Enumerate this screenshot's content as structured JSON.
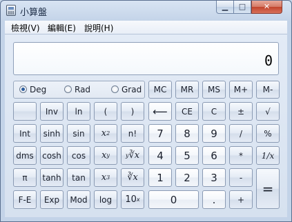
{
  "window": {
    "title": "小算盤"
  },
  "menu": {
    "items": [
      {
        "label": "檢視(V)"
      },
      {
        "label": "編輯(E)"
      },
      {
        "label": "說明(H)"
      }
    ]
  },
  "display": {
    "value": "0"
  },
  "angle": {
    "options": [
      "Deg",
      "Rad",
      "Grad"
    ],
    "selected": "Deg"
  },
  "memory": {
    "mc": "MC",
    "mr": "MR",
    "ms": "MS",
    "mplus": "M+",
    "mminus": "M-"
  },
  "sci": {
    "inv": "Inv",
    "ln": "ln",
    "lparen": "(",
    "rparen": ")",
    "int": "Int",
    "sinh": "sinh",
    "sin": "sin",
    "x2": "x",
    "x2_sup": "2",
    "nfact": "n!",
    "dms": "dms",
    "cosh": "cosh",
    "cos": "cos",
    "xy": "x",
    "xy_sup": "y",
    "yroot": "∛x",
    "pi": "π",
    "tanh": "tanh",
    "tan": "tan",
    "x3": "x",
    "x3_sup": "3",
    "croot": "∛x",
    "fe": "F-E",
    "exp": "Exp",
    "mod": "Mod",
    "log": "log",
    "ten": "10",
    "ten_sup": "x"
  },
  "keys": {
    "back": "⟵",
    "ce": "CE",
    "c": "C",
    "pm": "±",
    "sqrt": "√",
    "n7": "7",
    "n8": "8",
    "n9": "9",
    "div": "/",
    "pct": "%",
    "n4": "4",
    "n5": "5",
    "n6": "6",
    "mul": "*",
    "recip": "1/x",
    "n1": "1",
    "n2": "2",
    "n3": "3",
    "sub": "-",
    "eq": "=",
    "n0": "0",
    "dot": ".",
    "add": "+"
  },
  "yroot_pre": "y"
}
